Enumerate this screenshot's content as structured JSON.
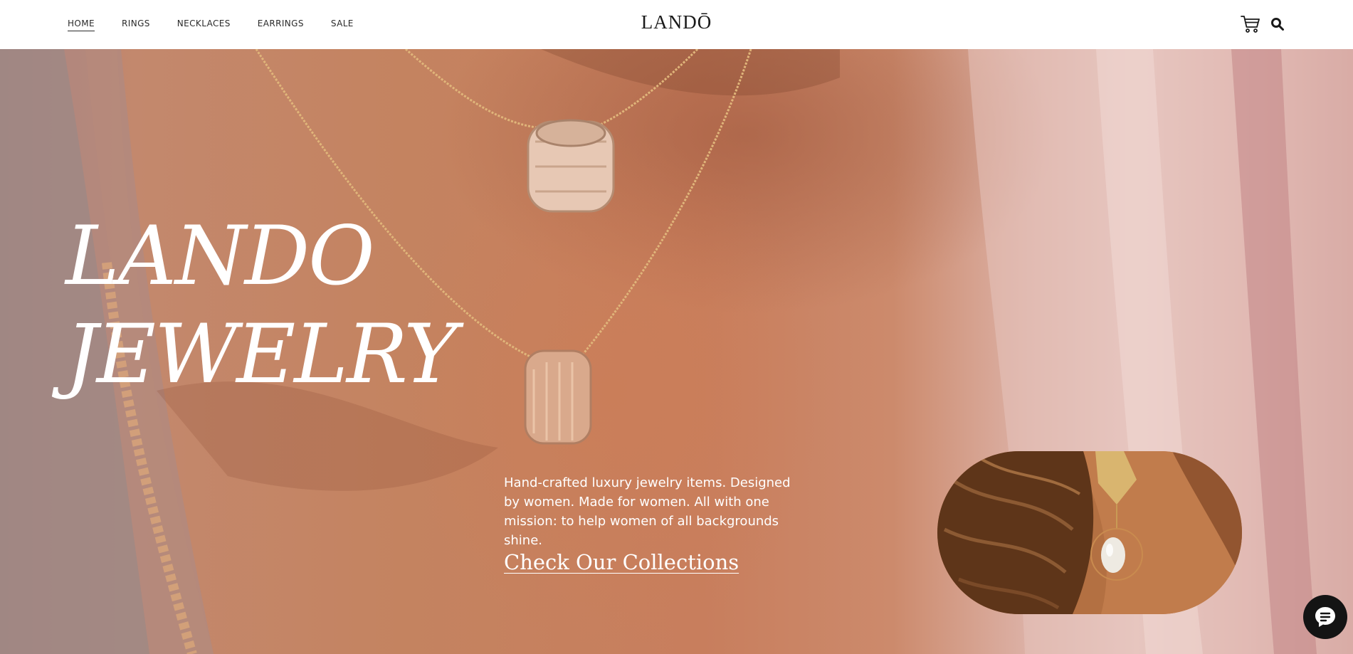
{
  "header": {
    "nav": [
      {
        "label": "HOME",
        "active": true
      },
      {
        "label": "RINGS",
        "active": false
      },
      {
        "label": "NECKLACES",
        "active": false
      },
      {
        "label": "EARRINGS",
        "active": false
      },
      {
        "label": "SALE",
        "active": false
      }
    ],
    "logo": "LANDŌ",
    "icons": [
      "cart-icon",
      "search-icon"
    ]
  },
  "hero": {
    "title_line1": "LANDO",
    "title_line2": "JEWELRY",
    "description": "Hand-crafted luxury jewelry items. Designed by women. Made for women. All with one mission: to help women of all backgrounds shine.",
    "cta_label": "Check Our Collections",
    "image_icons": [
      "necklace-photo",
      "earring-photo"
    ]
  },
  "chat": {
    "icon": "chat-icon"
  },
  "colors": {
    "text_dark": "#1a1a1a",
    "hero_text": "#ffffff",
    "hero_skin": "#c8805f",
    "chat_bg": "#141414"
  }
}
